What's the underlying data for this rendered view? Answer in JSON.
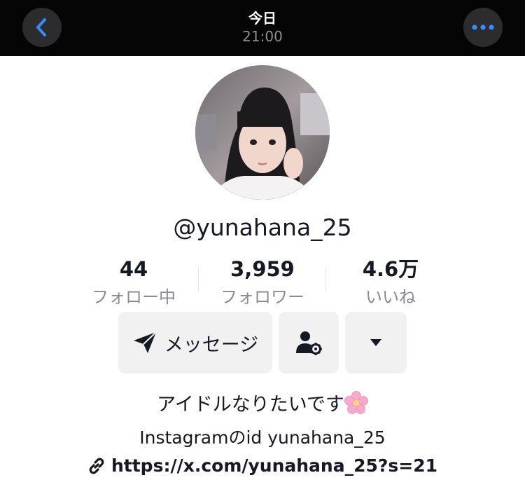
{
  "header": {
    "title": "今日",
    "time": "21:00",
    "back_icon": "chevron-left-icon",
    "more_icon": "ellipsis-icon"
  },
  "profile": {
    "username": "@yunahana_25",
    "stats": [
      {
        "value": "44",
        "label": "フォロー中"
      },
      {
        "value": "3,959",
        "label": "フォロワー"
      },
      {
        "value": "4.6万",
        "label": "いいね"
      }
    ],
    "actions": {
      "message_label": "メッセージ",
      "message_icon": "send-icon",
      "follow_icon": "user-settings-icon",
      "dropdown_icon": "caret-down-icon"
    },
    "bio": {
      "line1": "アイドルなりたいです",
      "emoji": "🌸",
      "line2": "Instagramのid yunahana_25"
    },
    "link": {
      "url": "https://x.com/yunahana_25?s=21",
      "icon": "link-icon"
    }
  },
  "colors": {
    "topbar": "#050505",
    "text": "#161823",
    "muted": "#8a8b91",
    "button_bg": "#f1f1f2",
    "accent_blue": "#3a8cf5"
  }
}
